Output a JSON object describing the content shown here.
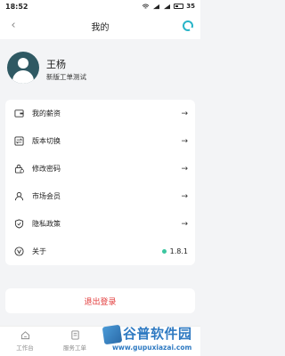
{
  "status_bar": {
    "time": "18:52",
    "battery": "35"
  },
  "header": {
    "title": "我的"
  },
  "profile": {
    "name": "王杨",
    "subtitle": "新版工单测试"
  },
  "menu": {
    "items": [
      {
        "label": "我的薪资",
        "icon": "wallet-icon"
      },
      {
        "label": "版本切换",
        "icon": "switch-icon"
      },
      {
        "label": "修改密码",
        "icon": "lock-icon"
      },
      {
        "label": "市场会员",
        "icon": "person-icon"
      },
      {
        "label": "隐私政策",
        "icon": "shield-icon"
      },
      {
        "label": "关于",
        "icon": "v-circle-icon",
        "version": "1.8.1"
      }
    ],
    "arrow": "→"
  },
  "logout": {
    "label": "退出登录"
  },
  "tabs": [
    {
      "label": "工作台",
      "icon": "home-icon"
    },
    {
      "label": "服务工单",
      "icon": "document-icon"
    }
  ],
  "watermark": {
    "title": "谷普软件园",
    "url": "www.gupuxiazai.com"
  },
  "colors": {
    "accent_teal": "#28b4c8",
    "logout_red": "#e23b3b",
    "version_dot": "#3cc6a0",
    "avatar_bg": "#2f5963"
  }
}
